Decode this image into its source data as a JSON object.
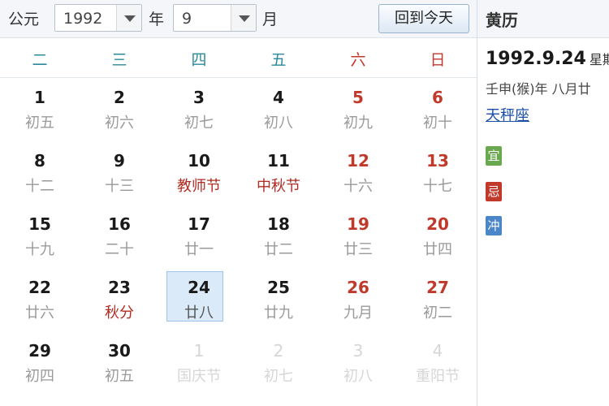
{
  "toolbar": {
    "calendar_label": "公元",
    "year_value": "1992",
    "year_label": "年",
    "month_value": "9",
    "month_label": "月",
    "today_button": "回到今天"
  },
  "weekdays": [
    {
      "label": "二",
      "color": "#2a8a9a"
    },
    {
      "label": "三",
      "color": "#2a8a9a"
    },
    {
      "label": "四",
      "color": "#2a8a9a"
    },
    {
      "label": "五",
      "color": "#2a8a9a"
    },
    {
      "label": "六",
      "color": "#c0392b"
    },
    {
      "label": "日",
      "color": "#c0392b"
    }
  ],
  "days": [
    [
      {
        "n": "1",
        "l": "初五"
      },
      {
        "n": "2",
        "l": "初六"
      },
      {
        "n": "3",
        "l": "初七"
      },
      {
        "n": "4",
        "l": "初八"
      },
      {
        "n": "5",
        "l": "初九"
      },
      {
        "n": "6",
        "l": "初十"
      }
    ],
    [
      {
        "n": "8",
        "l": "十二"
      },
      {
        "n": "9",
        "l": "十三"
      },
      {
        "n": "10",
        "l": "教师节",
        "hol": true
      },
      {
        "n": "11",
        "l": "中秋节",
        "hol": true
      },
      {
        "n": "12",
        "l": "十六"
      },
      {
        "n": "13",
        "l": "十七"
      }
    ],
    [
      {
        "n": "15",
        "l": "十九"
      },
      {
        "n": "16",
        "l": "二十"
      },
      {
        "n": "17",
        "l": "廿一"
      },
      {
        "n": "18",
        "l": "廿二"
      },
      {
        "n": "19",
        "l": "廿三"
      },
      {
        "n": "20",
        "l": "廿四"
      }
    ],
    [
      {
        "n": "22",
        "l": "廿六"
      },
      {
        "n": "23",
        "l": "秋分",
        "hol": true
      },
      {
        "n": "24",
        "l": "廿八",
        "sel": true
      },
      {
        "n": "25",
        "l": "廿九"
      },
      {
        "n": "26",
        "l": "九月"
      },
      {
        "n": "27",
        "l": "初二"
      }
    ],
    [
      {
        "n": "29",
        "l": "初四"
      },
      {
        "n": "30",
        "l": "初五"
      },
      {
        "n": "1",
        "l": "国庆节",
        "other": true
      },
      {
        "n": "2",
        "l": "初七",
        "other": true
      },
      {
        "n": "3",
        "l": "初八",
        "other": true
      },
      {
        "n": "4",
        "l": "重阳节",
        "other": true
      }
    ]
  ],
  "side": {
    "title": "黄历",
    "date": "1992.9.24",
    "weekday_partial": "星期",
    "lunar": "壬申(猴)年 八月廿",
    "constellation": "天秤座",
    "tags": [
      {
        "label": "宜",
        "color": "#6aa84f"
      },
      {
        "label": "忌",
        "color": "#c0392b"
      },
      {
        "label": "冲",
        "color": "#4a86c8"
      }
    ]
  }
}
